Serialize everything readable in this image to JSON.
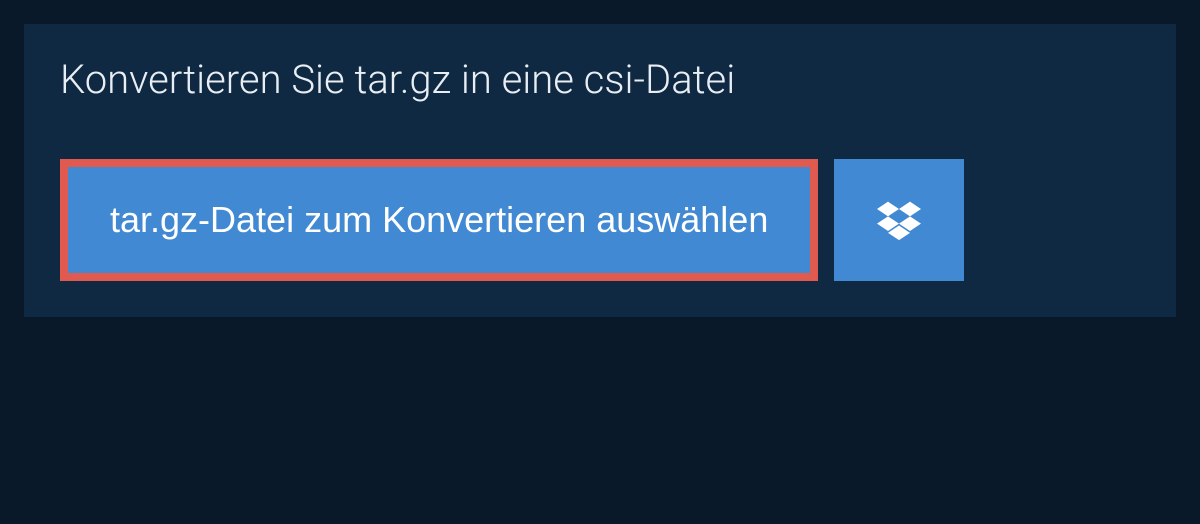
{
  "card": {
    "title": "Konvertieren Sie tar.gz in eine csi-Datei"
  },
  "buttons": {
    "select_file": "tar.gz-Datei zum Konvertieren auswählen"
  },
  "colors": {
    "page_bg": "#0a1929",
    "card_bg": "#0f2942",
    "button_bg": "#4189d3",
    "highlight_border": "#e05a4f",
    "text_light": "#e8eef4",
    "text_white": "#ffffff"
  }
}
